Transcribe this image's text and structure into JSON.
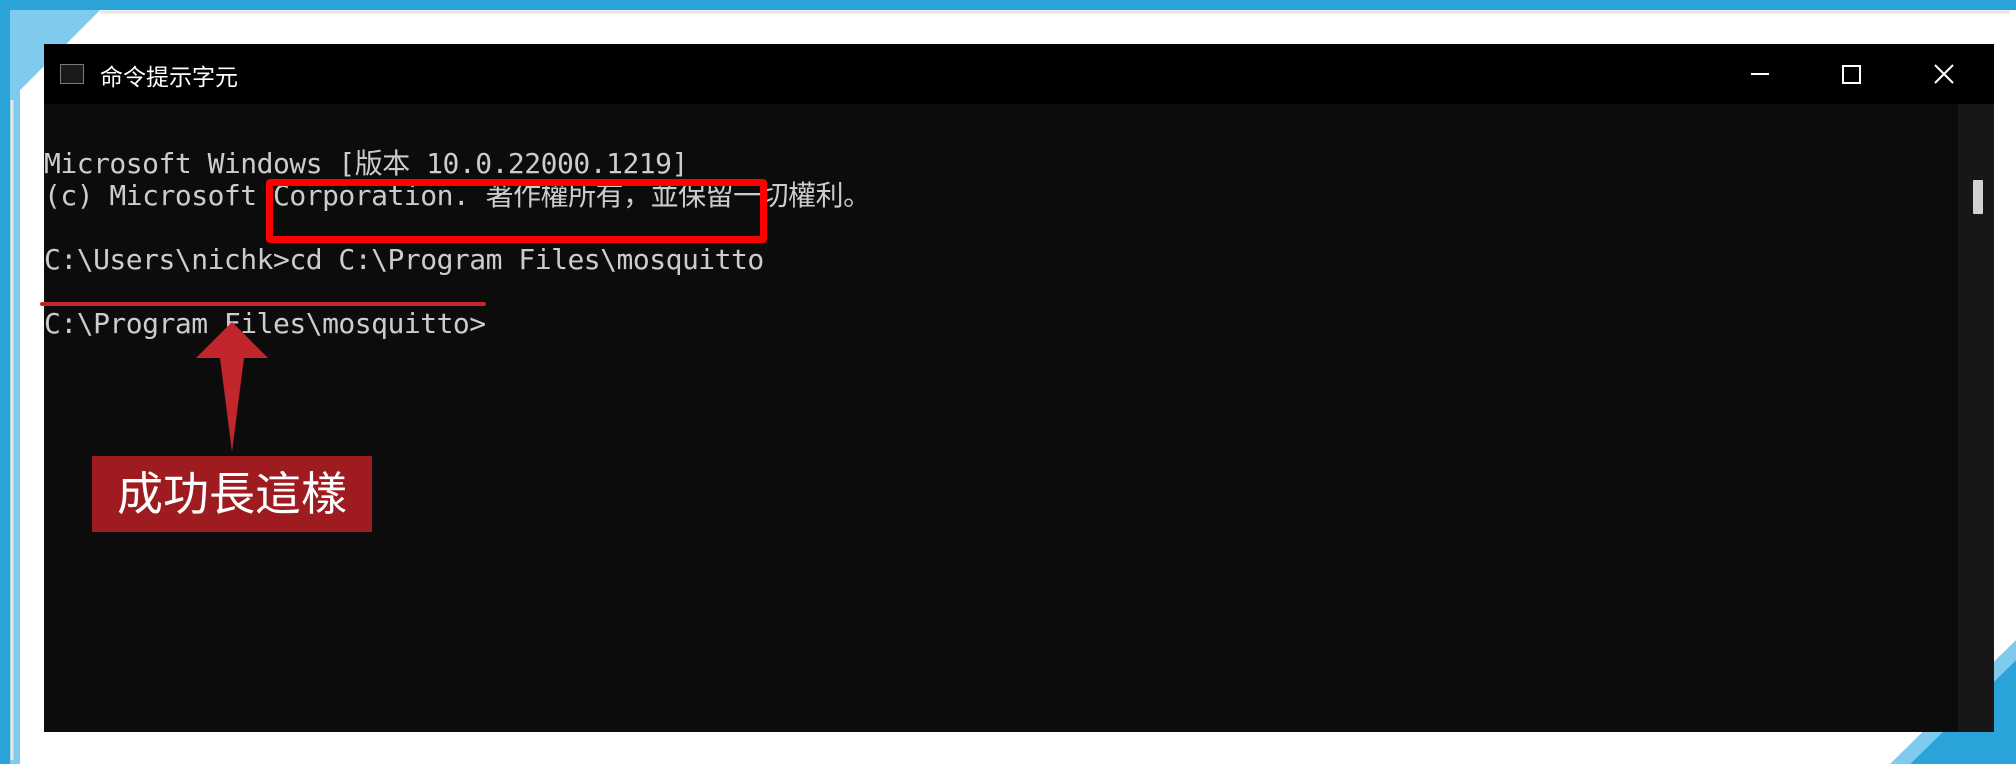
{
  "window": {
    "title": "命令提示字元",
    "icon": "console-icon",
    "controls": {
      "minimize_icon": "minimize-icon",
      "maximize_icon": "maximize-icon",
      "close_icon": "close-icon"
    }
  },
  "console": {
    "lines": [
      "Microsoft Windows [版本 10.0.22000.1219]",
      "(c) Microsoft Corporation. 著作權所有，並保留一切權利。",
      "C:\\Users\\nichk>cd C:\\Program Files\\mosquitto",
      "C:\\Program Files\\mosquitto>"
    ],
    "text_color": "#cccccc",
    "background": "#0c0c0c"
  },
  "annotation": {
    "label": "成功長這樣",
    "highlight_color": "#ff0000",
    "label_color": "#9e1b20",
    "arrow_color": "#c0262b"
  },
  "colors": {
    "frame_blue": "#2aa3d8",
    "title_bar": "#000000"
  }
}
